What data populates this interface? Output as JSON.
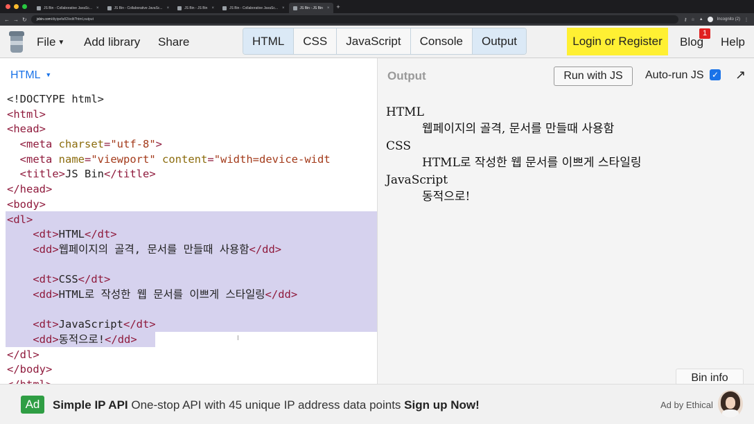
{
  "browser": {
    "tabs": [
      {
        "label": "JS Bin - Collaborative JavaSc..."
      },
      {
        "label": "JS Bin - Collaborative JavaSc..."
      },
      {
        "label": "JS Bin - JS Bin"
      },
      {
        "label": "JS Bin - Collaborative JavaSc..."
      },
      {
        "label": "JS Bin - JS Bin"
      }
    ],
    "url_host": "jsbin.com",
    "url_path": "/diyipefaf/2/edit?html,output",
    "profile": "Incognito (2)"
  },
  "toolbar": {
    "file_label": "File",
    "add_library_label": "Add library",
    "share_label": "Share",
    "panels": [
      {
        "label": "HTML",
        "active": true
      },
      {
        "label": "CSS",
        "active": false
      },
      {
        "label": "JavaScript",
        "active": false
      },
      {
        "label": "Console",
        "active": false
      },
      {
        "label": "Output",
        "active": true
      }
    ],
    "login_label": "Login or Register",
    "blog_label": "Blog",
    "blog_badge": "1",
    "help_label": "Help",
    "login_color": "#fff033"
  },
  "editor": {
    "language_label": "HTML",
    "code_lines": [
      [
        {
          "t": "tx",
          "s": "<!DOCTYPE html>"
        }
      ],
      [
        {
          "t": "tg",
          "s": "<html>"
        }
      ],
      [
        {
          "t": "tg",
          "s": "<head>"
        }
      ],
      [
        {
          "t": "tx",
          "s": "  "
        },
        {
          "t": "tg",
          "s": "<meta "
        },
        {
          "t": "at",
          "s": "charset"
        },
        {
          "t": "tg",
          "s": "="
        },
        {
          "t": "st",
          "s": "\"utf-8\""
        },
        {
          "t": "tg",
          "s": ">"
        }
      ],
      [
        {
          "t": "tx",
          "s": "  "
        },
        {
          "t": "tg",
          "s": "<meta "
        },
        {
          "t": "at",
          "s": "name"
        },
        {
          "t": "tg",
          "s": "="
        },
        {
          "t": "st",
          "s": "\"viewport\""
        },
        {
          "t": "tx",
          "s": " "
        },
        {
          "t": "at",
          "s": "content"
        },
        {
          "t": "tg",
          "s": "="
        },
        {
          "t": "st",
          "s": "\"width=device-widt"
        }
      ],
      [
        {
          "t": "tx",
          "s": "  "
        },
        {
          "t": "tg",
          "s": "<title>"
        },
        {
          "t": "tx",
          "s": "JS Bin"
        },
        {
          "t": "tg",
          "s": "</title>"
        }
      ],
      [
        {
          "t": "tg",
          "s": "</head>"
        }
      ],
      [
        {
          "t": "tg",
          "s": "<body>"
        }
      ],
      [
        {
          "t": "tg",
          "s": "<dl>"
        }
      ],
      [
        {
          "t": "tx",
          "s": "    "
        },
        {
          "t": "tg",
          "s": "<dt>"
        },
        {
          "t": "tx",
          "s": "HTML"
        },
        {
          "t": "tg",
          "s": "</dt>"
        }
      ],
      [
        {
          "t": "tx",
          "s": "    "
        },
        {
          "t": "tg",
          "s": "<dd>"
        },
        {
          "t": "tx",
          "s": "웹페이지의 골격, 문서를 만들때 사용함"
        },
        {
          "t": "tg",
          "s": "</dd>"
        }
      ],
      [
        {
          "t": "tx",
          "s": ""
        }
      ],
      [
        {
          "t": "tx",
          "s": "    "
        },
        {
          "t": "tg",
          "s": "<dt>"
        },
        {
          "t": "tx",
          "s": "CSS"
        },
        {
          "t": "tg",
          "s": "</dt>"
        }
      ],
      [
        {
          "t": "tx",
          "s": "    "
        },
        {
          "t": "tg",
          "s": "<dd>"
        },
        {
          "t": "tx",
          "s": "HTML로 작성한 웹 문서를 이쁘게 스타일링"
        },
        {
          "t": "tg",
          "s": "</dd>"
        }
      ],
      [
        {
          "t": "tx",
          "s": ""
        }
      ],
      [
        {
          "t": "tx",
          "s": "    "
        },
        {
          "t": "tg",
          "s": "<dt>"
        },
        {
          "t": "tx",
          "s": "JavaScript"
        },
        {
          "t": "tg",
          "s": "</dt>"
        }
      ],
      [
        {
          "t": "tx",
          "s": "    "
        },
        {
          "t": "tg",
          "s": "<dd>"
        },
        {
          "t": "tx",
          "s": "동적으로!"
        },
        {
          "t": "tg",
          "s": "</dd>"
        }
      ],
      [
        {
          "t": "tg",
          "s": "</dl>"
        }
      ],
      [
        {
          "t": "tg",
          "s": "</body>"
        }
      ],
      [
        {
          "t": "tg",
          "s": "</html>"
        }
      ]
    ],
    "selection_color": "#d6d2ee"
  },
  "output": {
    "label": "Output",
    "run_button_label": "Run with JS",
    "auto_run_label": "Auto-run JS",
    "auto_run_checked": true,
    "bin_info_label": "Bin info",
    "definitions": [
      {
        "term": "HTML",
        "desc": "웹페이지의 골격, 문서를 만들때 사용함"
      },
      {
        "term": "CSS",
        "desc": "HTML로 작성한 웹 문서를 이쁘게 스타일링"
      },
      {
        "term": "JavaScript",
        "desc": "동적으로!"
      }
    ]
  },
  "ad": {
    "tag": "Ad",
    "brand": "Simple IP API",
    "text": " One-stop API with 45 unique IP address data points ",
    "cta": "Sign up Now!",
    "by_label": "Ad by Ethical",
    "tag_color": "#2f9e44"
  }
}
